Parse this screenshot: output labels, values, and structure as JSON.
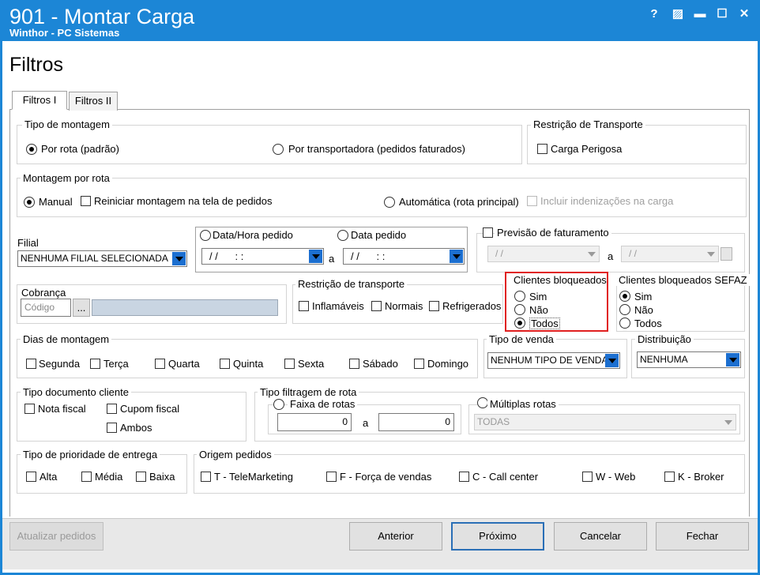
{
  "window": {
    "title": "901 - Montar Carga",
    "subtitle": "Winthor - PC Sistemas",
    "help_glyph": "?",
    "edit_glyph": "▨",
    "minimize_glyph": "▬",
    "maximize_glyph": "☐",
    "close_glyph": "✕"
  },
  "page_title": "Filtros",
  "tabs": [
    {
      "label": "Filtros I",
      "active": true
    },
    {
      "label": "Filtros II",
      "active": false
    }
  ],
  "tipo_montagem": {
    "title": "Tipo de montagem",
    "options": [
      "Por rota (padrão)",
      "Por transportadora (pedidos faturados)"
    ],
    "selected": 0
  },
  "restricao_transporte_top": {
    "title": "Restrição de Transporte",
    "carga_perigosa": "Carga Perigosa"
  },
  "montagem_rota": {
    "title": "Montagem por rota",
    "manual": "Manual",
    "reiniciar": "Reiniciar montagem na tela de pedidos",
    "automatica": "Automática (rota principal)",
    "incluir": "Incluir indenizações na carga"
  },
  "filial": {
    "label": "Filial",
    "value": "NENHUMA FILIAL SELECIONADA"
  },
  "datas": {
    "data_hora_label": "Data/Hora pedido",
    "data_pedido_label": "Data pedido",
    "date_from": "/ /      : :",
    "date_to": "/ /      : :",
    "a": "a"
  },
  "previsao": {
    "label": "Previsão de faturamento",
    "from": "/ /",
    "to": "/ /",
    "a": "a"
  },
  "cobranca": {
    "label": "Cobrança",
    "placeholder": "Código",
    "btn": "..."
  },
  "restricao_transporte": {
    "title": "Restrição de transporte",
    "options": [
      "Inflamáveis",
      "Normais",
      "Refrigerados"
    ]
  },
  "clientes_bloqueados": {
    "title": "Clientes bloqueados",
    "options": [
      "Sim",
      "Não",
      "Todos"
    ],
    "selected": 2,
    "highlight_color": "#e02020"
  },
  "clientes_bloqueados_sefaz": {
    "title": "Clientes bloqueados SEFAZ",
    "options": [
      "Sim",
      "Não",
      "Todos"
    ],
    "selected": 0
  },
  "dias_montagem": {
    "title": "Dias de montagem",
    "days": [
      "Segunda",
      "Terça",
      "Quarta",
      "Quinta",
      "Sexta",
      "Sábado",
      "Domingo"
    ]
  },
  "tipo_venda": {
    "title": "Tipo de venda",
    "value": "NENHUM TIPO DE VENDA"
  },
  "distribuicao": {
    "title": "Distribuição",
    "value": "NENHUMA"
  },
  "tipo_documento": {
    "title": "Tipo documento cliente",
    "nota_fiscal": "Nota fiscal",
    "cupom_fiscal": "Cupom fiscal",
    "ambos": "Ambos"
  },
  "tipo_filtragem": {
    "title": "Tipo filtragem de rota",
    "faixa_label": "Faixa de rotas",
    "faixa_from": "0",
    "faixa_to": "0",
    "a": "a",
    "multiplas_label": "Múltiplas rotas",
    "multiplas_value": "TODAS"
  },
  "prioridade": {
    "title": "Tipo de prioridade de  entrega",
    "options": [
      "Alta",
      "Média",
      "Baixa"
    ]
  },
  "origem": {
    "title": "Origem pedidos",
    "options": [
      "T - TeleMarketing",
      "F - Força de vendas",
      "C - Call center",
      "W - Web",
      "K - Broker"
    ]
  },
  "buttons": {
    "atualizar": "Atualizar pedidos",
    "anterior": "Anterior",
    "proximo": "Próximo",
    "cancelar": "Cancelar",
    "fechar": "Fechar"
  }
}
